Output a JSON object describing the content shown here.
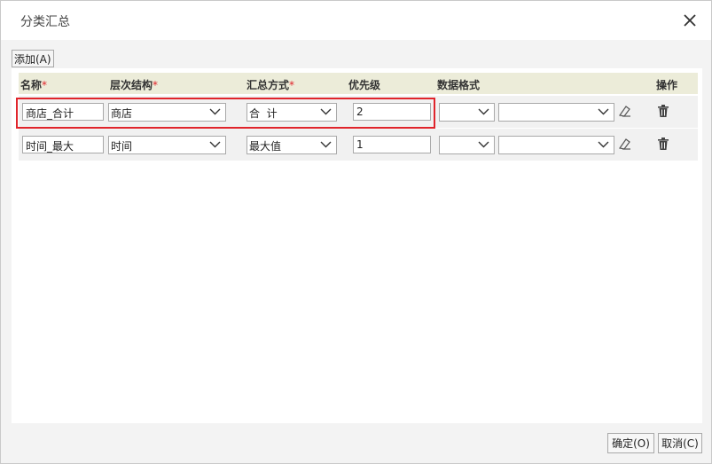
{
  "dialog": {
    "title": "分类汇总"
  },
  "toolbar": {
    "add_label": "添加(A)"
  },
  "table": {
    "headers": {
      "name": "名称",
      "hierarchy": "层次结构",
      "method": "汇总方式",
      "priority": "优先级",
      "format": "数据格式",
      "actions": "操作",
      "required_mark": "*"
    },
    "rows": [
      {
        "name": "商店_合计",
        "hierarchy": "商店",
        "method": "合  计",
        "priority": "2",
        "format_type": "",
        "format_value": ""
      },
      {
        "name": "时间_最大",
        "hierarchy": "时间",
        "method": "最大值",
        "priority": "1",
        "format_type": "",
        "format_value": ""
      }
    ]
  },
  "footer": {
    "ok_label": "确定(O)",
    "cancel_label": "取消(C)"
  },
  "colors": {
    "header_bg": "#ececd9",
    "highlight": "#e0242b",
    "required": "#e0242b"
  }
}
